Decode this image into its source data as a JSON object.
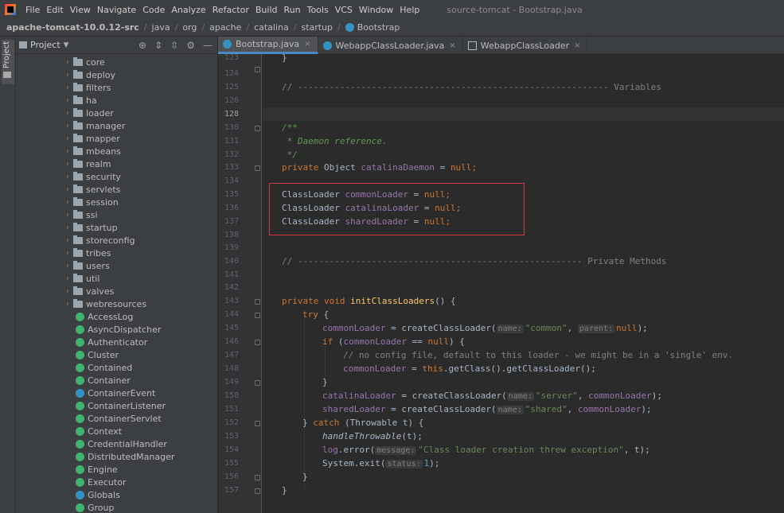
{
  "menubar": {
    "items": [
      "File",
      "Edit",
      "View",
      "Navigate",
      "Code",
      "Analyze",
      "Refactor",
      "Build",
      "Run",
      "Tools",
      "VCS",
      "Window",
      "Help"
    ],
    "window_title": "source-tomcat - Bootstrap.java"
  },
  "breadcrumbs": {
    "project": "apache-tomcat-10.0.12-src",
    "path": [
      "java",
      "org",
      "apache",
      "catalina",
      "startup"
    ],
    "current": "Bootstrap"
  },
  "left_strip": {
    "label": "Project"
  },
  "project_panel": {
    "title": "Project",
    "tree": [
      {
        "type": "folder",
        "label": "core"
      },
      {
        "type": "folder",
        "label": "deploy"
      },
      {
        "type": "folder",
        "label": "filters"
      },
      {
        "type": "folder",
        "label": "ha"
      },
      {
        "type": "folder",
        "label": "loader"
      },
      {
        "type": "folder",
        "label": "manager"
      },
      {
        "type": "folder",
        "label": "mapper"
      },
      {
        "type": "folder",
        "label": "mbeans"
      },
      {
        "type": "folder",
        "label": "realm"
      },
      {
        "type": "folder",
        "label": "security"
      },
      {
        "type": "folder",
        "label": "servlets"
      },
      {
        "type": "folder",
        "label": "session"
      },
      {
        "type": "folder",
        "label": "ssi"
      },
      {
        "type": "folder",
        "label": "startup"
      },
      {
        "type": "folder",
        "label": "storeconfig"
      },
      {
        "type": "folder",
        "label": "tribes"
      },
      {
        "type": "folder",
        "label": "users"
      },
      {
        "type": "folder",
        "label": "util"
      },
      {
        "type": "folder",
        "label": "valves"
      },
      {
        "type": "folder",
        "label": "webresources"
      },
      {
        "type": "interface",
        "label": "AccessLog"
      },
      {
        "type": "interface",
        "label": "AsyncDispatcher"
      },
      {
        "type": "interface",
        "label": "Authenticator"
      },
      {
        "type": "interface",
        "label": "Cluster"
      },
      {
        "type": "interface",
        "label": "Contained"
      },
      {
        "type": "interface",
        "label": "Container"
      },
      {
        "type": "class",
        "label": "ContainerEvent"
      },
      {
        "type": "interface",
        "label": "ContainerListener"
      },
      {
        "type": "interface",
        "label": "ContainerServlet"
      },
      {
        "type": "interface",
        "label": "Context"
      },
      {
        "type": "interface",
        "label": "CredentialHandler"
      },
      {
        "type": "interface",
        "label": "DistributedManager"
      },
      {
        "type": "interface",
        "label": "Engine"
      },
      {
        "type": "interface",
        "label": "Executor"
      },
      {
        "type": "class",
        "label": "Globals"
      },
      {
        "type": "interface",
        "label": "Group"
      }
    ]
  },
  "tabs": [
    {
      "label": "Bootstrap.java",
      "active": true,
      "icon": "java-class-icon"
    },
    {
      "label": "WebappClassLoader.java",
      "active": false,
      "icon": "java-class-icon"
    },
    {
      "label": "WebappClassLoader",
      "active": false,
      "icon": "structure-icon"
    }
  ],
  "editor": {
    "line_numbers": [
      "123",
      "124",
      "125",
      "126",
      "128",
      "130",
      "131",
      "132",
      "133",
      "134",
      "135",
      "136",
      "137",
      "138",
      "139",
      "140",
      "141",
      "142",
      "143",
      "144",
      "145",
      "146",
      "147",
      "148",
      "149",
      "150",
      "151",
      "152",
      "153",
      "154",
      "155",
      "156",
      "157"
    ],
    "current_line_number": "128",
    "lines": {
      "l124_brace": "}",
      "l125_variables": "// ----------------------------------------------------------- Variables",
      "l130_doc_open": "/**",
      "l131_doc_text": " * Daemon reference.",
      "l132_doc_close": " */",
      "l133_private": "private",
      "l133_type": " Object ",
      "l133_field": "catalinaDaemon",
      "l133_rest": " = ",
      "l133_null": "null",
      "l135_type": "ClassLoader ",
      "l135_field": "commonLoader",
      "l136_field": "catalinaLoader",
      "l137_field": "sharedLoader",
      "assign": " = ",
      "null": "null",
      "semi": ";",
      "l140_private_methods": "// ------------------------------------------------------ Private Methods",
      "l143_private": "private",
      "l143_void": " void ",
      "l143_method": "initClassLoaders",
      "l143_rest": "() {",
      "l144_try": "try",
      "l144_rest": " {",
      "l145_pre": " = createClassLoader(",
      "hint_name": "name:",
      "hint_parent": "parent:",
      "hint_message": "message:",
      "hint_status": "status:",
      "str_common": "\"common\"",
      "str_server": "\"server\"",
      "str_shared": "\"shared\"",
      "l146_if": "if",
      "l146_open": " (",
      "l146_eq": " == ",
      "l146_close": ") {",
      "l147_comment": "// no config file, default to this loader - we might be in a 'single' env.",
      "l148_this": "this",
      "l148_rest": ".getClass().getClassLoader();",
      "l152_catch_kw": "catch",
      "l152_rest": " (Throwable t) {",
      "l153_fn": "handleThrowable",
      "l153_rest": "(t);",
      "l154_log": "log",
      "l154_error": ".error(",
      "l154_str": "\"Class loader creation threw exception\"",
      "l154_rest": ", t);",
      "l155_exit": "System.exit(",
      "l155_num": "1",
      "l155_rest": ");"
    }
  },
  "colors": {
    "keyword": "#cc7832",
    "field": "#9876aa",
    "string": "#6a8759",
    "comment": "#808080",
    "doc_comment": "#629755",
    "highlight_box": "#d03a3a",
    "active_tab_underline": "#4a88c7"
  }
}
